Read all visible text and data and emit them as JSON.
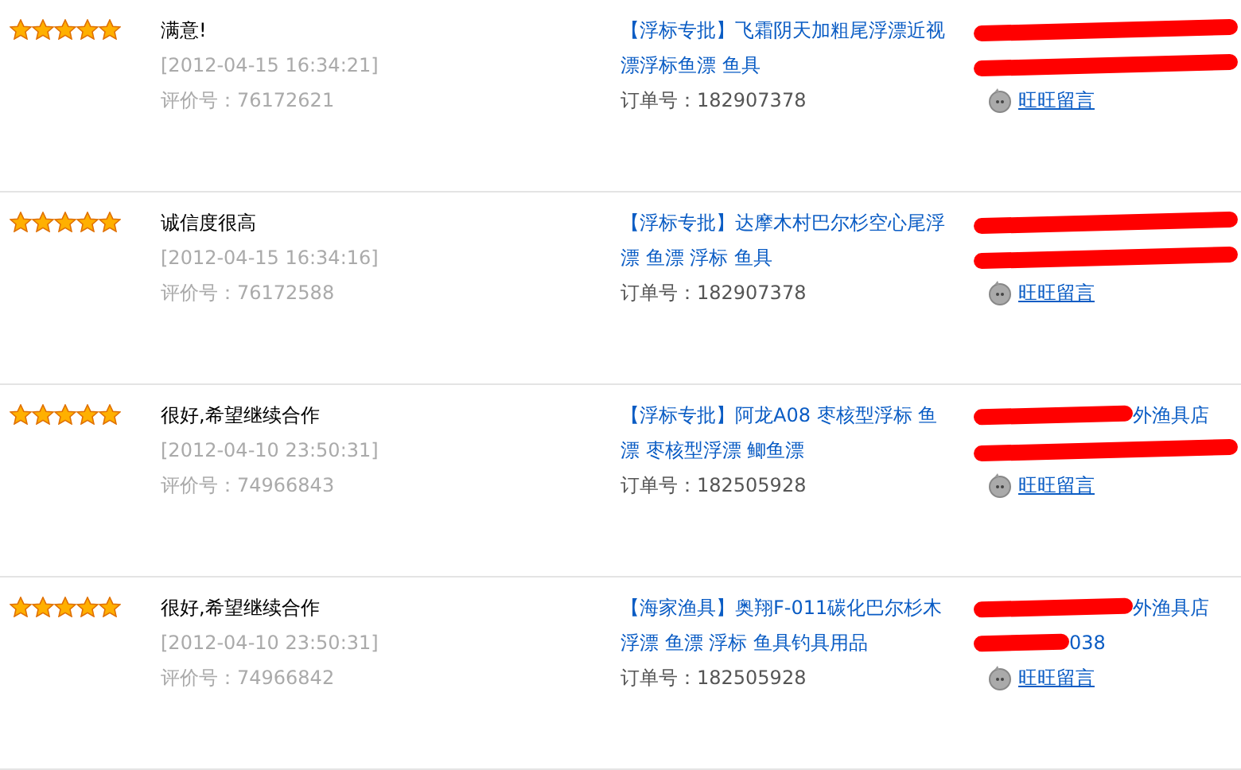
{
  "reviews": [
    {
      "stars": 5,
      "comment": "满意!",
      "time": "[2012-04-15 16:34:21]",
      "review_no": "评价号：76172621",
      "item": "【浮标专批】飞霜阴天加粗尾浮漂近视漂浮标鱼漂 鱼具",
      "order_no": "订单号：182907378",
      "seller_name": {
        "redacted": true
      },
      "seller_id": {
        "redacted": true
      },
      "contact": "旺旺留言"
    },
    {
      "stars": 5,
      "comment": "诚信度很高",
      "time": "[2012-04-15 16:34:16]",
      "review_no": "评价号：76172588",
      "item": "【浮标专批】达摩木村巴尔杉空心尾浮漂 鱼漂 浮标 鱼具",
      "order_no": "订单号：182907378",
      "seller_name": {
        "redacted": true
      },
      "seller_id": {
        "redacted": true
      },
      "contact": "旺旺留言"
    },
    {
      "stars": 5,
      "comment": "很好,希望继续合作",
      "time": "[2012-04-10 23:50:31]",
      "review_no": "评价号：74966843",
      "item": "【浮标专批】阿龙A08 枣核型浮标 鱼漂 枣核型浮漂 鲫鱼漂",
      "order_no": "订单号：182505928",
      "seller_name": {
        "visible": "外渔具店",
        "redacted": true
      },
      "seller_id": {
        "redacted": true
      },
      "contact": "旺旺留言"
    },
    {
      "stars": 5,
      "comment": "很好,希望继续合作",
      "time": "[2012-04-10 23:50:31]",
      "review_no": "评价号：74966842",
      "item": "【海家渔具】奥翔F-011碳化巴尔杉木浮漂 鱼漂 浮标 鱼具钓具用品",
      "order_no": "订单号：182505928",
      "seller_name": {
        "visible": "外渔具店",
        "redacted": true
      },
      "seller_id": {
        "visible": "038",
        "redacted": true
      },
      "contact": "旺旺留言"
    }
  ]
}
